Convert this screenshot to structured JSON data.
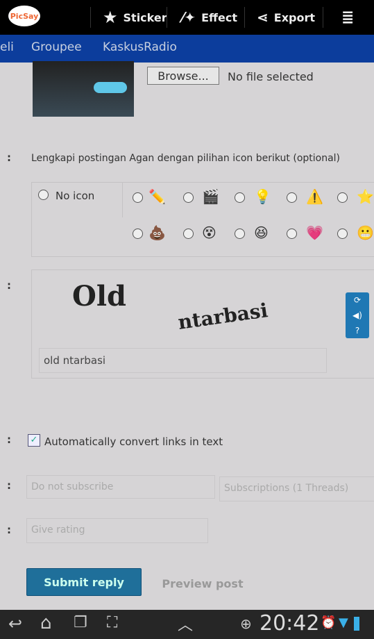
{
  "app": {
    "logo": "PicSay",
    "toolbar": [
      {
        "label": "Sticker",
        "icon": "star-icon"
      },
      {
        "label": "Effect",
        "icon": "magic-wand-icon"
      },
      {
        "label": "Export",
        "icon": "share-icon"
      }
    ],
    "menu_icon": "overflow-menu-icon"
  },
  "nav": {
    "items": [
      "eli",
      "Groupee",
      "KaskusRadio"
    ]
  },
  "upload": {
    "browse_label": "Browse...",
    "status": "No file selected"
  },
  "icons_section": {
    "label": "Lengkapi postingan Agan dengan pilihan icon berikut (optional)",
    "no_icon": "No icon",
    "row1": [
      "✏️",
      "🎬",
      "💡",
      "⚠️",
      "⭐"
    ],
    "row2": [
      "💩",
      "😵",
      "😆",
      "💗",
      "😬"
    ]
  },
  "captcha": {
    "word1": "Old",
    "word2": "ntarbasi",
    "input_value": "old ntarbasi",
    "buttons": [
      "refresh-icon",
      "audio-icon",
      "help-icon"
    ]
  },
  "options": {
    "auto_links_label": "Automatically convert links in text",
    "auto_links_checked": true,
    "subscribe_select": "Do not subscribe",
    "subscriptions_select": "Subscriptions (1 Threads)",
    "rating_select": "Give rating"
  },
  "actions": {
    "submit": "Submit reply",
    "preview": "Preview post"
  },
  "statusbar": {
    "time": "20:42"
  },
  "colors": {
    "nav": "#0c3d9c",
    "submit": "#1f6f9a",
    "toolbar": "#000000"
  }
}
